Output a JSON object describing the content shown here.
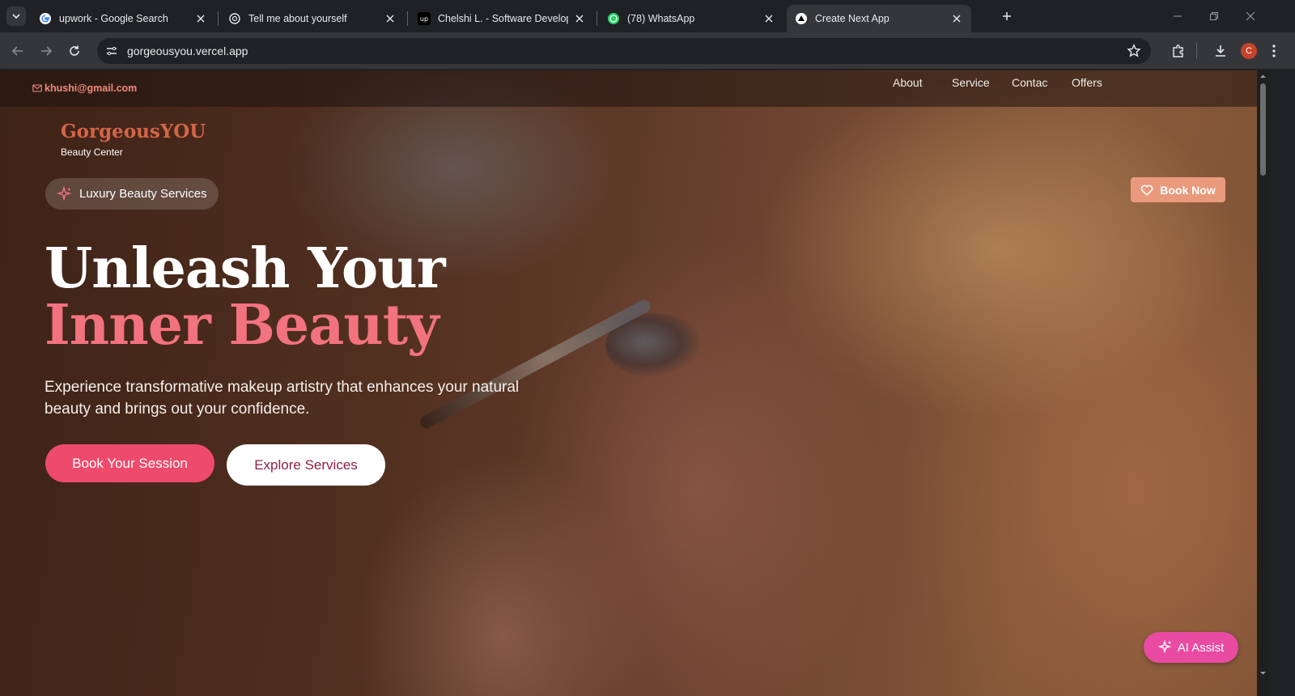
{
  "browser": {
    "tabs": [
      {
        "label": "upwork - Google Search",
        "icon": "google-icon",
        "active": false
      },
      {
        "label": "Tell me about yourself",
        "icon": "chatgpt-icon",
        "active": false
      },
      {
        "label": "Chelshi L. - Software Developer",
        "icon": "upwork-icon",
        "active": false
      },
      {
        "label": "(78) WhatsApp",
        "icon": "whatsapp-icon",
        "active": false
      },
      {
        "label": "Create Next App",
        "icon": "nextjs-icon",
        "active": true
      }
    ],
    "url": "gorgeousyou.vercel.app",
    "profile_initial": "C"
  },
  "site": {
    "email": "khushi@gmail.com",
    "nav": [
      "About",
      "Service",
      "Contac",
      "Offers"
    ],
    "logo_title": "GorgeousYOU",
    "logo_subtitle": "Beauty Center",
    "badge": "Luxury Beauty Services",
    "book_now": "Book Now",
    "headline_line1": "Unleash Your",
    "headline_line2": "Inner Beauty",
    "lead": "Experience transformative makeup artistry that enhances your natural beauty and brings out your confidence.",
    "cta_primary": "Book Your Session",
    "cta_secondary": "Explore Services",
    "ai_assist": "AI Assist"
  },
  "colors": {
    "accent_pink": "#ee4a6c",
    "headline_pink": "#f2727f",
    "logo_orange": "#d46547",
    "book_now_bg": "#e99a7d",
    "ai_assist_bg": "#e94ba3"
  }
}
